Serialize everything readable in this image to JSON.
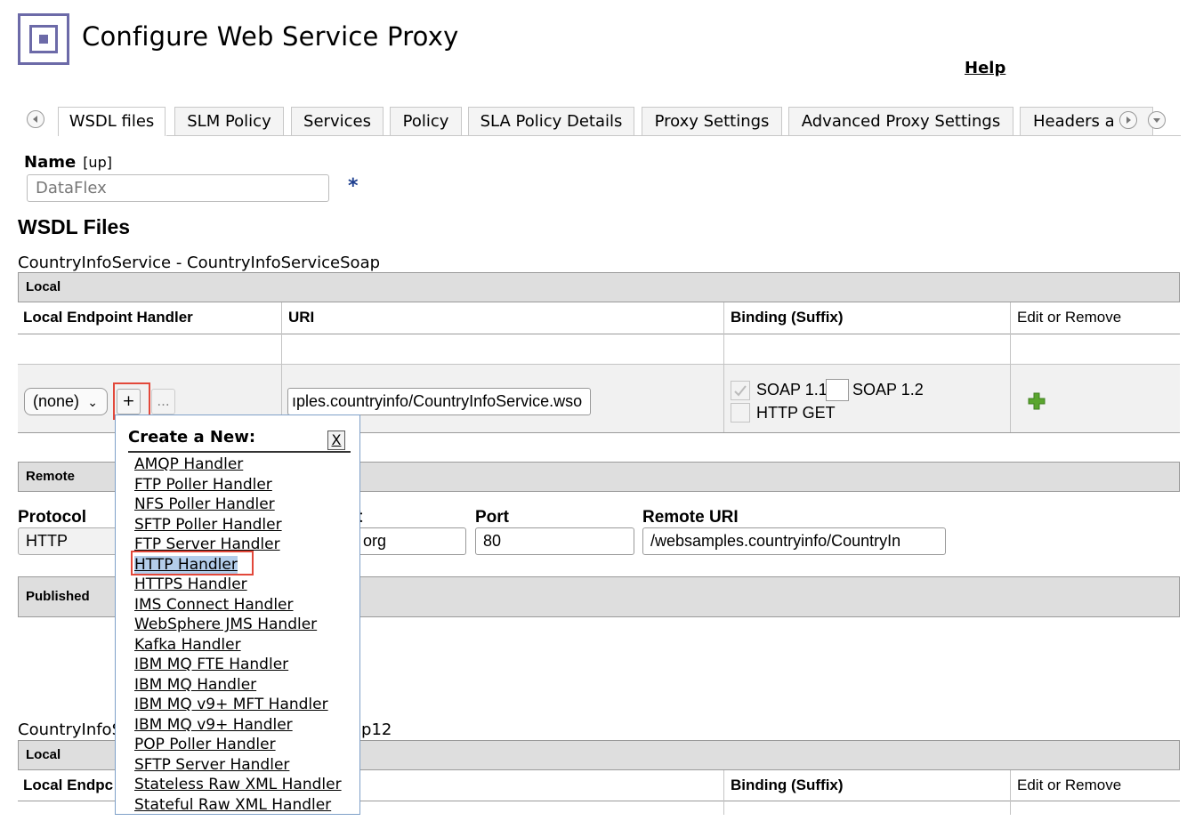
{
  "header": {
    "title": "Configure Web Service Proxy",
    "help_label": "Help"
  },
  "tabs": [
    {
      "label": "WSDL files",
      "active": true
    },
    {
      "label": "SLM Policy"
    },
    {
      "label": "Services"
    },
    {
      "label": "Policy"
    },
    {
      "label": "SLA Policy Details"
    },
    {
      "label": "Proxy Settings"
    },
    {
      "label": "Advanced Proxy Settings"
    },
    {
      "label": "Headers a"
    }
  ],
  "name_field": {
    "label": "Name",
    "tag": "[up]",
    "value": "DataFlex",
    "required_marker": "*"
  },
  "section_title": "WSDL Files",
  "service1": {
    "title": "CountryInfoService - CountryInfoServiceSoap",
    "local_bar": "Local",
    "columns": [
      "Local Endpoint Handler",
      "URI",
      "Binding (Suffix)",
      "Edit or Remove"
    ],
    "handler_select": "(none)",
    "plus_label": "+",
    "dots_label": "...",
    "uri_value": "ıples.countryinfo/CountryInfoService.wso",
    "bindings": {
      "soap11": "SOAP 1.1",
      "soap12": "SOAP 1.2",
      "httpget": "HTTP GET"
    },
    "remote_bar": "Remote",
    "remote": {
      "protocol_label": "Protocol",
      "protocol_value": "HTTP",
      "host_label_fragment": "t",
      "host_value_fragment": "org",
      "port_label": "Port",
      "port_value": "80",
      "remote_uri_label": "Remote URI",
      "remote_uri_value": "/websamples.countryinfo/CountryIn"
    },
    "published_bar": "Published"
  },
  "service2": {
    "title_left": "CountryInfoS",
    "title_right": "ap12",
    "local_bar": "Local",
    "col1_fragment": "Local Endpc",
    "binding_header": "Binding (Suffix)",
    "edit_header": "Edit or Remove"
  },
  "popup": {
    "title": "Create a New:",
    "close_label": "X",
    "items": [
      "AMQP Handler",
      "FTP Poller Handler",
      "NFS Poller Handler",
      "SFTP Poller Handler",
      "FTP Server Handler",
      "HTTP Handler",
      "HTTPS Handler",
      "IMS Connect Handler",
      "WebSphere JMS Handler",
      "Kafka Handler",
      "IBM MQ FTE Handler",
      "IBM MQ Handler",
      "IBM MQ v9+ MFT Handler",
      "IBM MQ v9+ Handler",
      "POP Poller Handler",
      "SFTP Server Handler",
      "Stateless Raw XML Handler",
      "Stateful Raw XML Handler"
    ],
    "selected_item": "HTTP Handler"
  },
  "colors": {
    "logo": "#6c6aa8",
    "highlight_border": "#e2483a",
    "selection_bg": "#b3cdea",
    "add_icon": "#5aa52e"
  }
}
